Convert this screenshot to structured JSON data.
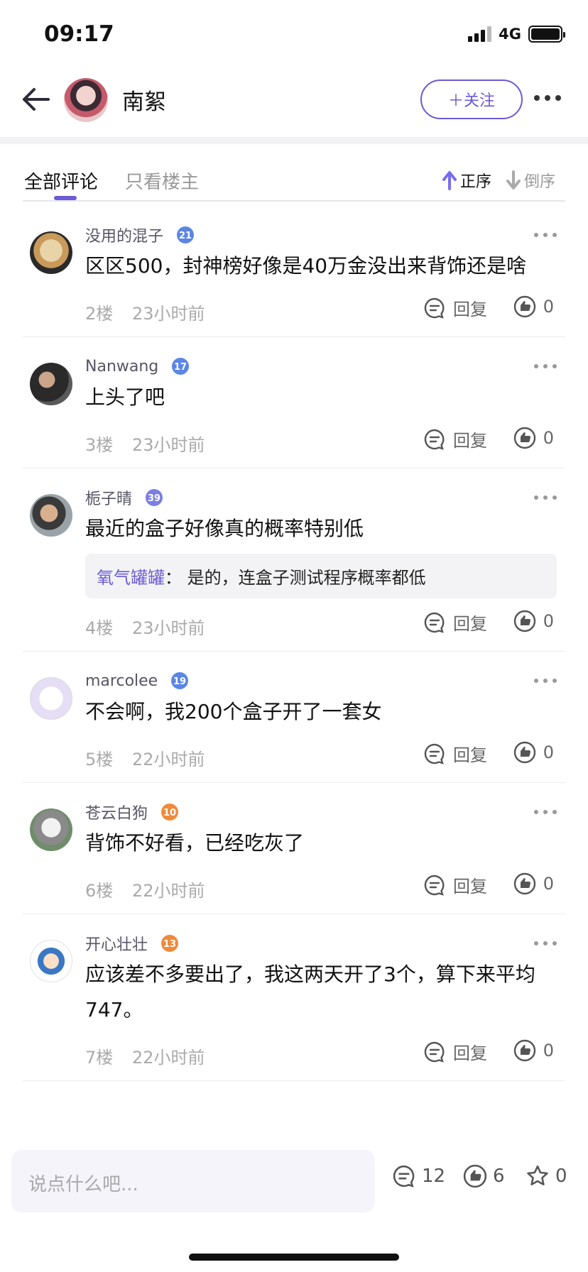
{
  "status_bar": {
    "time": "09:17",
    "network": "4G"
  },
  "header": {
    "name": "南絮",
    "follow_label": "＋关注"
  },
  "tabs": {
    "all": "全部评论",
    "owner_only": "只看楼主",
    "sort_asc": "正序",
    "sort_desc": "倒序"
  },
  "comments": [
    {
      "user": "没用的混子",
      "level": "21",
      "text": "区区500，封神榜好像是40万金没出来背饰还是啥",
      "floor": "2楼",
      "time": "23小时前",
      "reply_label": "回复",
      "likes": "0"
    },
    {
      "user": "Nanwang",
      "level": "17",
      "text": "上头了吧",
      "floor": "3楼",
      "time": "23小时前",
      "reply_label": "回复",
      "likes": "0"
    },
    {
      "user": "栀子晴",
      "level": "39",
      "text": "最近的盒子好像真的概率特别低",
      "reply_user": "氧气罐罐",
      "reply_sep": "：",
      "reply_text": "是的，连盒子测试程序概率都低",
      "floor": "4楼",
      "time": "23小时前",
      "reply_label": "回复",
      "likes": "0"
    },
    {
      "user": "marcolee",
      "level": "19",
      "text": "不会啊，我200个盒子开了一套女",
      "floor": "5楼",
      "time": "22小时前",
      "reply_label": "回复",
      "likes": "0"
    },
    {
      "user": "苍云白狗",
      "level": "10",
      "text": "背饰不好看，已经吃灰了",
      "floor": "6楼",
      "time": "22小时前",
      "reply_label": "回复",
      "likes": "0"
    },
    {
      "user": "开心壮壮",
      "level": "13",
      "text": "应该差不多要出了，我这两天开了3个，算下来平均747。",
      "floor": "7楼",
      "time": "22小时前",
      "reply_label": "回复",
      "likes": "0"
    }
  ],
  "bottom": {
    "placeholder": "说点什么吧...",
    "comment_count": "12",
    "like_count": "6",
    "fav_count": "0"
  },
  "colors": {
    "accent": "#6b5bd6",
    "badge_blue": "#5b86e5",
    "badge_orange": "#f08a3c"
  }
}
